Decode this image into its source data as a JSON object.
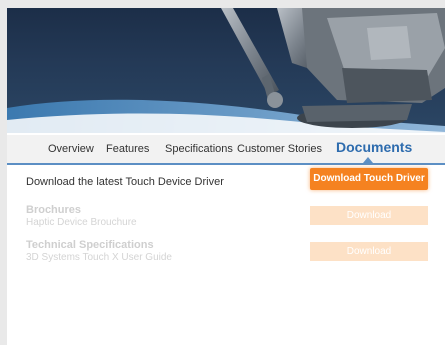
{
  "tabs": [
    {
      "label": "Overview",
      "active": false
    },
    {
      "label": "Features",
      "active": false
    },
    {
      "label": "Specifications",
      "active": false
    },
    {
      "label": "Customer Stories",
      "active": false
    },
    {
      "label": "Documents",
      "active": true
    }
  ],
  "driver": {
    "text": "Download the latest Touch Device Driver",
    "button_label": "Download Touch Driver"
  },
  "sections": [
    {
      "title": "Brochures",
      "subtitle": "Haptic Device Brouchure",
      "button_label": "Download"
    },
    {
      "title": "Technical Specifications",
      "subtitle": "3D Systems Touch X User Guide",
      "button_label": "Download"
    }
  ],
  "colors": {
    "accent_orange": "#f58220",
    "tab_active": "#2e6cae",
    "hero_dark": "#1c2e48"
  }
}
